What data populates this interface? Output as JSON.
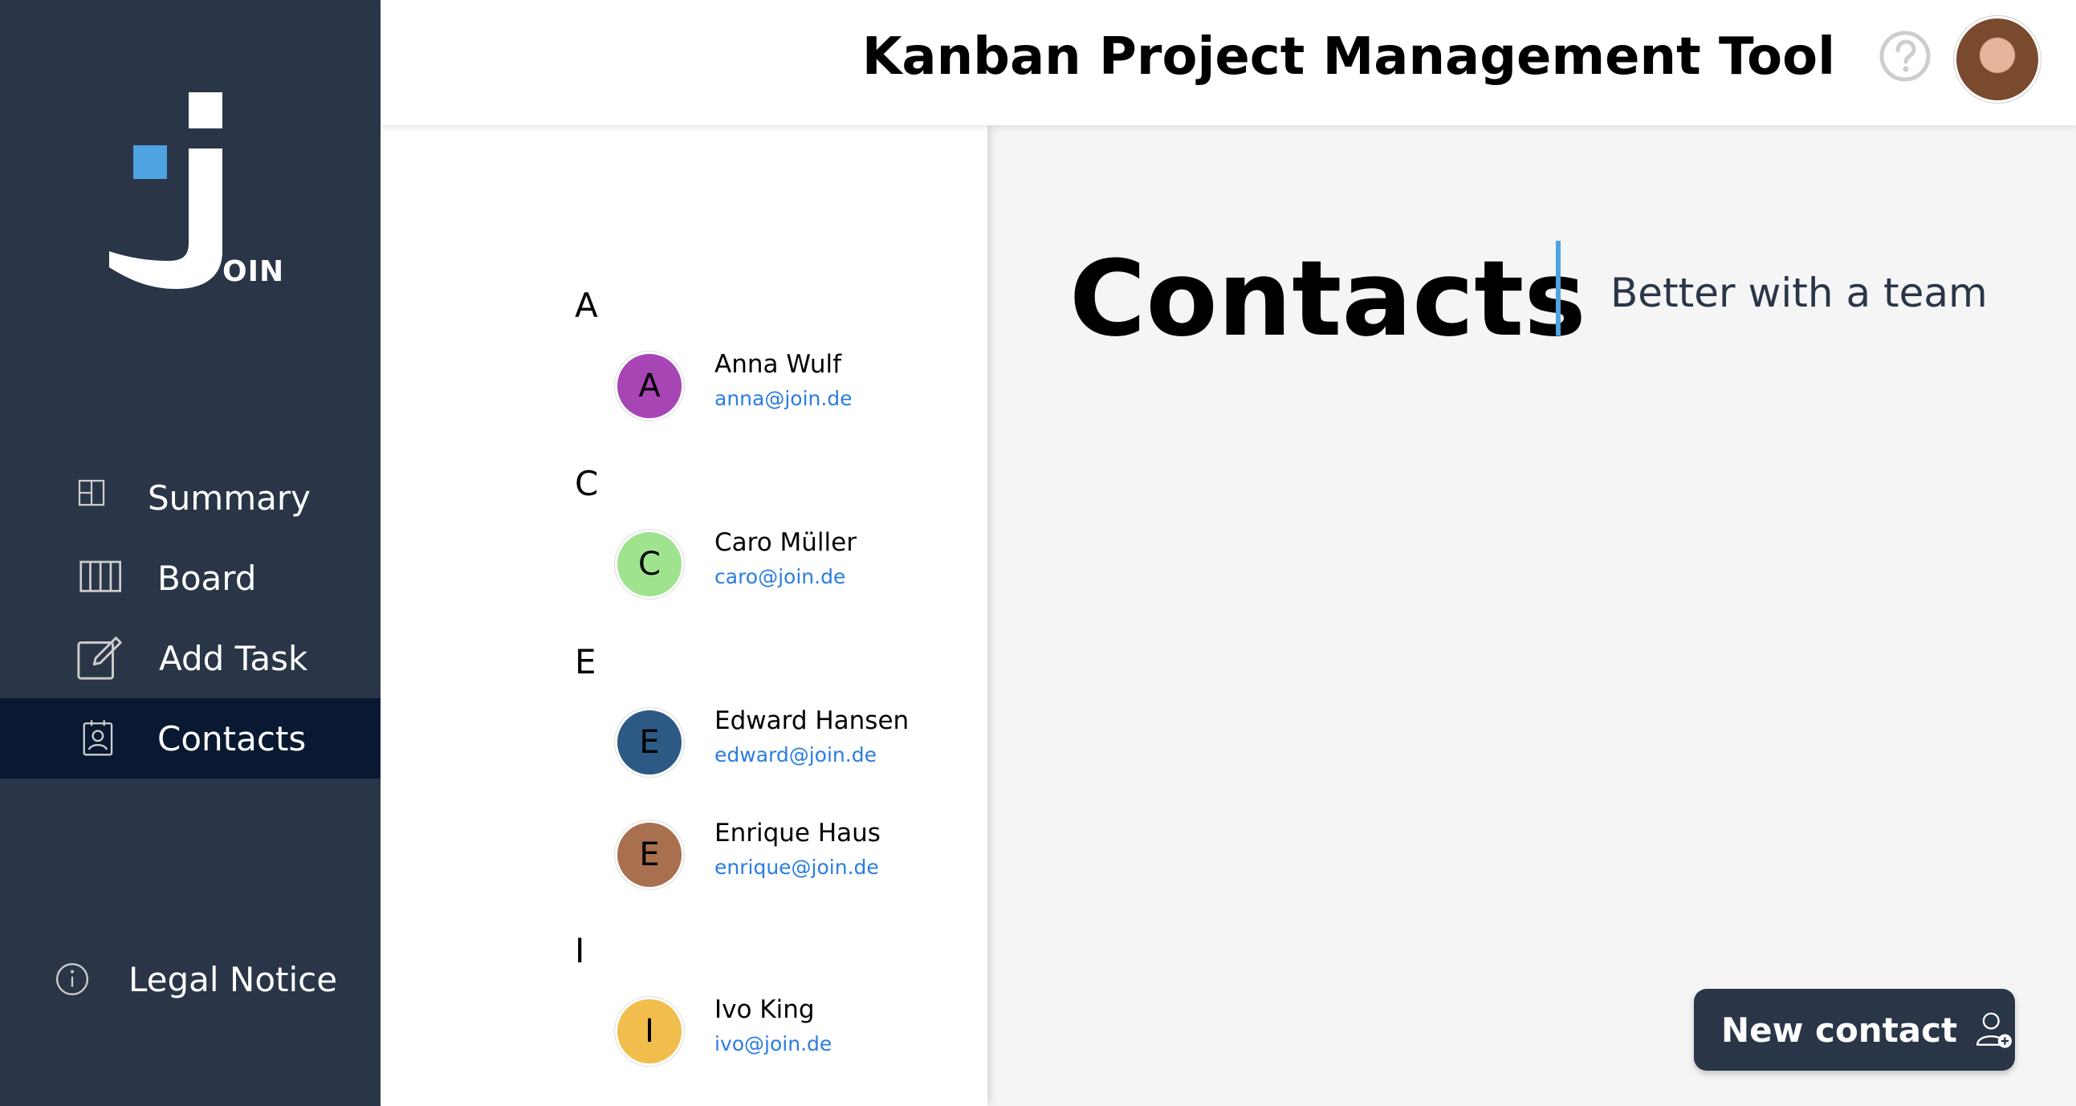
{
  "app": {
    "logo_text": "OIN",
    "header_title": "Kanban Project Management Tool"
  },
  "sidebar": {
    "items": [
      {
        "label": "Summary",
        "icon": "summary-icon"
      },
      {
        "label": "Board",
        "icon": "board-icon"
      },
      {
        "label": "Add Task",
        "icon": "add-task-icon"
      },
      {
        "label": "Contacts",
        "icon": "contacts-icon",
        "active": true
      }
    ],
    "legal": {
      "label": "Legal Notice",
      "icon": "info-icon"
    }
  },
  "contacts": {
    "groups": [
      {
        "letter": "A",
        "items": [
          {
            "initial": "A",
            "name": "Anna Wulf",
            "email": "anna@join.de",
            "color": "#a845b5"
          }
        ]
      },
      {
        "letter": "C",
        "items": [
          {
            "initial": "C",
            "name": "Caro Müller",
            "email": "caro@join.de",
            "color": "#9fe38f"
          }
        ]
      },
      {
        "letter": "E",
        "items": [
          {
            "initial": "E",
            "name": "Edward Hansen",
            "email": "edward@join.de",
            "color": "#2c5a85"
          },
          {
            "initial": "E",
            "name": "Enrique Haus",
            "email": "enrique@join.de",
            "color": "#a8704f"
          }
        ]
      },
      {
        "letter": "I",
        "items": [
          {
            "initial": "I",
            "name": "Ivo King",
            "email": "ivo@join.de",
            "color": "#f1bd4c"
          }
        ]
      }
    ]
  },
  "main": {
    "title": "Contacts",
    "subtitle": "Better with a team",
    "new_contact_label": "New contact"
  },
  "colors": {
    "sidebar_bg": "#2a3647",
    "active_bg": "#091931",
    "accent_blue": "#4ea3e0",
    "email_link": "#2a7de1"
  }
}
